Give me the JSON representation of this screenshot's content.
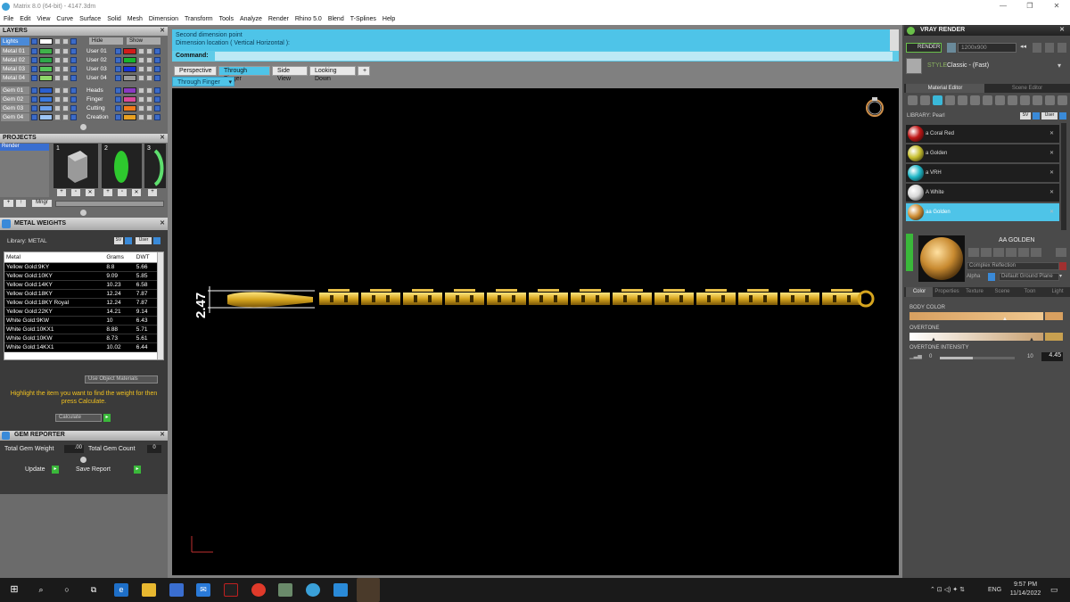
{
  "app": {
    "title": "Matrix 8.0 (64-bit) - 4147.3dm"
  },
  "menu": [
    "File",
    "Edit",
    "View",
    "Curve",
    "Surface",
    "Solid",
    "Mesh",
    "Dimension",
    "Transform",
    "Tools",
    "Analyze",
    "Render",
    "Rhino 5.0",
    "Blend",
    "T-Splines",
    "Help"
  ],
  "layers": {
    "title": "LAYERS",
    "lights_label": "Lights",
    "hide_label": "Hide",
    "show_label": "Show",
    "left": [
      {
        "name": "Metal 01",
        "color": "#3fb24a"
      },
      {
        "name": "Metal 02",
        "color": "#2ea84a"
      },
      {
        "name": "Metal 03",
        "color": "#55c65a"
      },
      {
        "name": "Metal 04",
        "color": "#8fd86a"
      },
      {
        "name": "Gem 01",
        "color": "#2a5fd0"
      },
      {
        "name": "Gem 02",
        "color": "#3b7ae0"
      },
      {
        "name": "Gem 03",
        "color": "#6aa0ee"
      },
      {
        "name": "Gem 04",
        "color": "#9cc4f6"
      }
    ],
    "right": [
      {
        "name": "User 01",
        "color": "#d11a1a"
      },
      {
        "name": "User 02",
        "color": "#17b32e"
      },
      {
        "name": "User 03",
        "color": "#1533d8"
      },
      {
        "name": "User 04",
        "color": "#9a9a9a"
      },
      {
        "name": "Heads",
        "color": "#8a3ac2"
      },
      {
        "name": "Finger",
        "color": "#d84a9a"
      },
      {
        "name": "Cutting",
        "color": "#f07a1a"
      },
      {
        "name": "Creation",
        "color": "#e8a020"
      }
    ]
  },
  "projects": {
    "title": "PROJECTS",
    "item": "Render",
    "nums": [
      "1",
      "2",
      "3"
    ],
    "mngr": "Mngr"
  },
  "metal_weights": {
    "title": "METAL WEIGHTS",
    "library": "Library: METAL",
    "sv": "SV",
    "user": "User",
    "headers": [
      "Metal",
      "Grams",
      "DWT"
    ],
    "rows": [
      [
        "Yellow Gold:9KY",
        "8.8",
        "5.66"
      ],
      [
        "Yellow Gold:10KY",
        "9.09",
        "5.85"
      ],
      [
        "Yellow Gold:14KY",
        "10.23",
        "6.58"
      ],
      [
        "Yellow Gold:18KY",
        "12.24",
        "7.87"
      ],
      [
        "Yellow Gold:18KY Royal",
        "12.24",
        "7.87"
      ],
      [
        "Yellow Gold:22KY",
        "14.21",
        "9.14"
      ],
      [
        "White Gold:9KW",
        "10",
        "6.43"
      ],
      [
        "White Gold:10KX1",
        "8.88",
        "5.71"
      ],
      [
        "White Gold:10KW",
        "8.73",
        "5.61"
      ],
      [
        "White Gold:14KX1",
        "10.02",
        "6.44"
      ]
    ],
    "use_object_materials": "Use Object Materials",
    "hint": "Highlight the item you want to find the weight for then press Calculate.",
    "calculate": "Calculate"
  },
  "gem_reporter": {
    "title": "GEM REPORTER",
    "total_gem_weight": "Total Gem Weight",
    "weight_value": ".00",
    "total_gem_count": "Total Gem Count",
    "count_value": "0",
    "update": "Update",
    "save_report": "Save Report"
  },
  "command": {
    "line1": "Second dimension point",
    "line2": "Dimension location ( Vertical  Horizontal ):",
    "label": "Command:"
  },
  "viewtabs": [
    "Perspective",
    "Through Finger",
    "Side View",
    "Looking Down"
  ],
  "active_view": "Through Finger",
  "dimension_label": "2.47",
  "vray": {
    "title": "VRAY RENDER",
    "render": "RENDER",
    "resolution": "1200x900",
    "style_label": "STYLE",
    "style_value": "Classic - (Fast)",
    "tabs": [
      "Material Editor",
      "Scene Editor"
    ],
    "library": "LIBRARY: Pearl",
    "sv": "SV",
    "user": "User",
    "materials": [
      {
        "name": "a Coral Red",
        "color": "#c01818"
      },
      {
        "name": "a Golden",
        "color": "#c8c030"
      },
      {
        "name": "a VRH",
        "color": "#20b8c8"
      },
      {
        "name": "A White",
        "color": "#d8d8d8"
      },
      {
        "name": "aa Golden",
        "color": "#d09038"
      }
    ],
    "selected_name": "AA GOLDEN",
    "reflection": "Complex Reflection",
    "alpha": "Alpha",
    "ground": "Default Ground Plane",
    "subtabs": [
      "Color",
      "Properties",
      "Texture",
      "Scene",
      "Toon",
      "Light"
    ],
    "body_color": "BODY COLOR",
    "overtone": "OVERTONE",
    "overtone_intensity": "OVERTONE INTENSITY",
    "slider_min": "0",
    "slider_max": "10",
    "slider_value": "4.45",
    "slider_fraction": 0.445
  },
  "taskbar": {
    "lang": "ENG",
    "time": "9:57 PM",
    "date": "11/14/2022"
  }
}
